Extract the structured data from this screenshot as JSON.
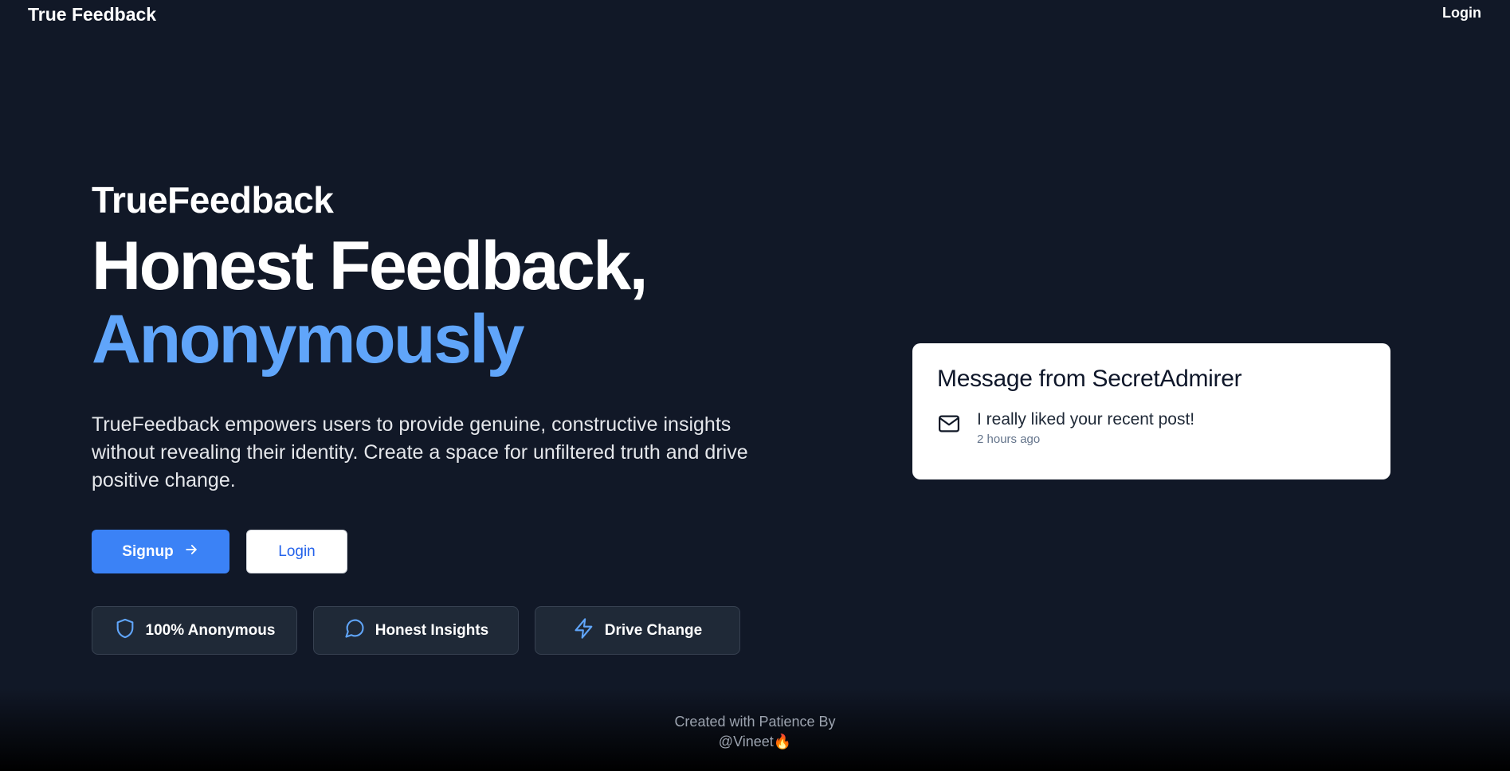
{
  "navbar": {
    "brand": "True Feedback",
    "login_label": "Login"
  },
  "hero": {
    "eyebrow": "TrueFeedback",
    "headline_line1": "Honest Feedback,",
    "headline_line2": "Anonymously",
    "description": "TrueFeedback empowers users to provide genuine, constructive insights without revealing their identity. Create a space for unfiltered truth and drive positive change.",
    "signup_label": "Signup",
    "login_label": "Login"
  },
  "features": [
    {
      "label": "100% Anonymous",
      "icon": "shield-icon"
    },
    {
      "label": "Honest Insights",
      "icon": "message-circle-icon"
    },
    {
      "label": "Drive Change",
      "icon": "zap-icon"
    }
  ],
  "card": {
    "title": "Message from SecretAdmirer",
    "message": "I really liked your recent post!",
    "time": "2 hours ago"
  },
  "footer": {
    "line1": "Created with Patience By",
    "line2": "@Vineet🔥"
  },
  "colors": {
    "background": "#111827",
    "accent": "#60a5fa",
    "primary_button": "#3b82f6"
  }
}
